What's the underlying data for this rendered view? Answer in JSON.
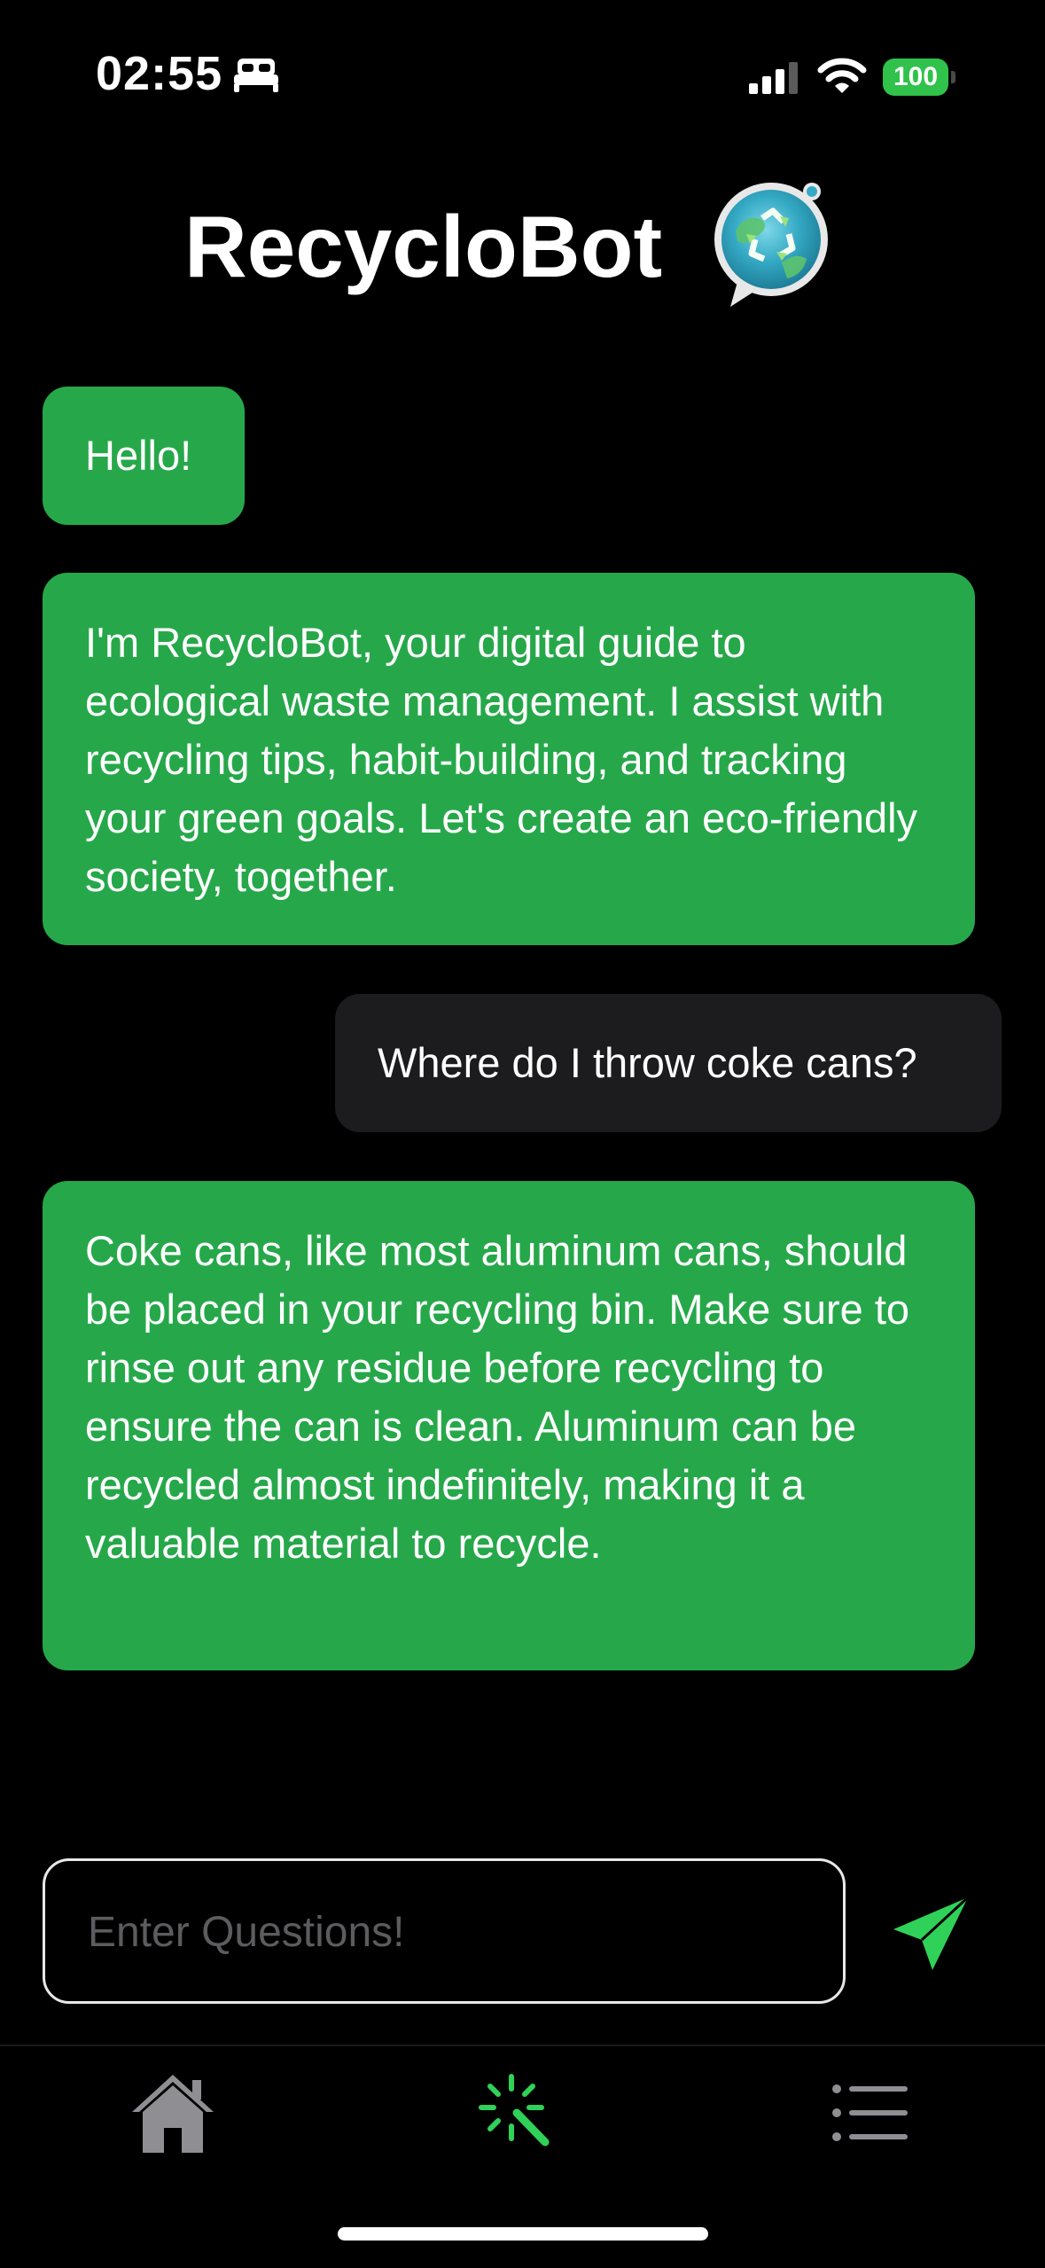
{
  "status_bar": {
    "time": "02:55",
    "battery": "100",
    "focus_icon": "bed-icon",
    "signal_icon": "cellular-signal-icon",
    "wifi_icon": "wifi-icon"
  },
  "header": {
    "title": "RecycloBot",
    "logo_icon": "recycle-chat-logo-icon"
  },
  "messages": [
    {
      "role": "bot",
      "text": "Hello!"
    },
    {
      "role": "bot",
      "text": "I'm RecycloBot, your digital guide to ecological waste management. I assist with recycling tips, habit-building, and tracking your green goals. Let's create an eco-friendly society, together."
    },
    {
      "role": "user",
      "text": "Where do I throw coke cans?"
    },
    {
      "role": "bot",
      "text": "Coke cans, like most aluminum cans, should be placed in your recycling bin. Make sure to rinse out any residue before recycling to ensure the can is clean. Aluminum can be recycled almost indefinitely, making it a valuable material to recycle."
    }
  ],
  "composer": {
    "placeholder": "Enter Questions!",
    "value": "",
    "send_icon": "paper-plane-send-icon"
  },
  "tab_bar": {
    "tabs": [
      {
        "icon": "home-icon",
        "active": false
      },
      {
        "icon": "magic-wand-icon",
        "active": true
      },
      {
        "icon": "list-icon",
        "active": false
      }
    ]
  },
  "colors": {
    "background": "#000000",
    "bot_bubble": "#26a84a",
    "user_bubble": "#1c1c1e",
    "accent": "#30d158",
    "battery": "#30c24b",
    "inactive_icon": "#8e8e93"
  }
}
